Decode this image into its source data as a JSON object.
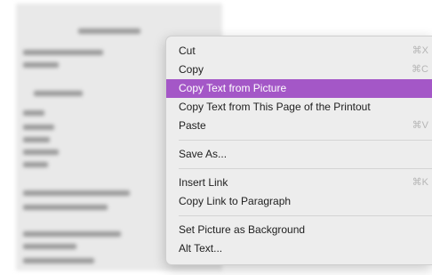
{
  "menu": {
    "groups": [
      [
        {
          "label": "Cut",
          "shortcut": "⌘X"
        },
        {
          "label": "Copy",
          "shortcut": "⌘C"
        },
        {
          "label": "Copy Text from Picture",
          "shortcut": "",
          "highlighted": true
        },
        {
          "label": "Copy Text from This Page of the Printout",
          "shortcut": ""
        },
        {
          "label": "Paste",
          "shortcut": "⌘V"
        }
      ],
      [
        {
          "label": "Save As...",
          "shortcut": ""
        }
      ],
      [
        {
          "label": "Insert Link",
          "shortcut": "⌘K"
        },
        {
          "label": "Copy Link to Paragraph",
          "shortcut": ""
        }
      ],
      [
        {
          "label": "Set Picture as Background",
          "shortcut": ""
        },
        {
          "label": "Alt Text...",
          "shortcut": ""
        }
      ]
    ],
    "highlight_color": "#a457c7"
  }
}
